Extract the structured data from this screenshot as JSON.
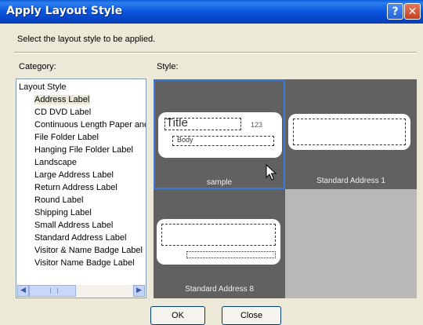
{
  "window": {
    "title": "Apply Layout Style",
    "help_label": "?",
    "close_label": "✕"
  },
  "instruction": "Select the layout style to be applied.",
  "category": {
    "label": "Category:",
    "root": "Layout Style",
    "items": [
      "Address Label",
      "CD DVD Label",
      "Continuous Length Paper and",
      "File Folder Label",
      "Hanging File Folder Label",
      "Landscape",
      "Large Address Label",
      "Return Address Label",
      "Round Label",
      "Shipping Label",
      "Small Address Label",
      "Standard Address Label",
      "Visitor & Name Badge Label",
      "Visitor Name Badge Label"
    ],
    "selected_index": 0
  },
  "style": {
    "label": "Style:",
    "tiles": [
      {
        "caption": "sample",
        "selected": true,
        "preview_title": "Title",
        "preview_number": "123",
        "preview_body": "Body"
      },
      {
        "caption": "Standard Address 1",
        "selected": false
      },
      {
        "caption": "Standard Address 8",
        "selected": false
      }
    ]
  },
  "buttons": {
    "ok": "OK",
    "close": "Close"
  },
  "colors": {
    "titlebar": "#0a5cd6",
    "dialog_bg": "#ece9d8",
    "selection_border": "#3c78d8",
    "tile_bg": "#616161"
  },
  "icons": [
    "help-icon",
    "close-icon",
    "scroll-left-arrow-icon",
    "scroll-right-arrow-icon",
    "mouse-cursor-icon"
  ]
}
